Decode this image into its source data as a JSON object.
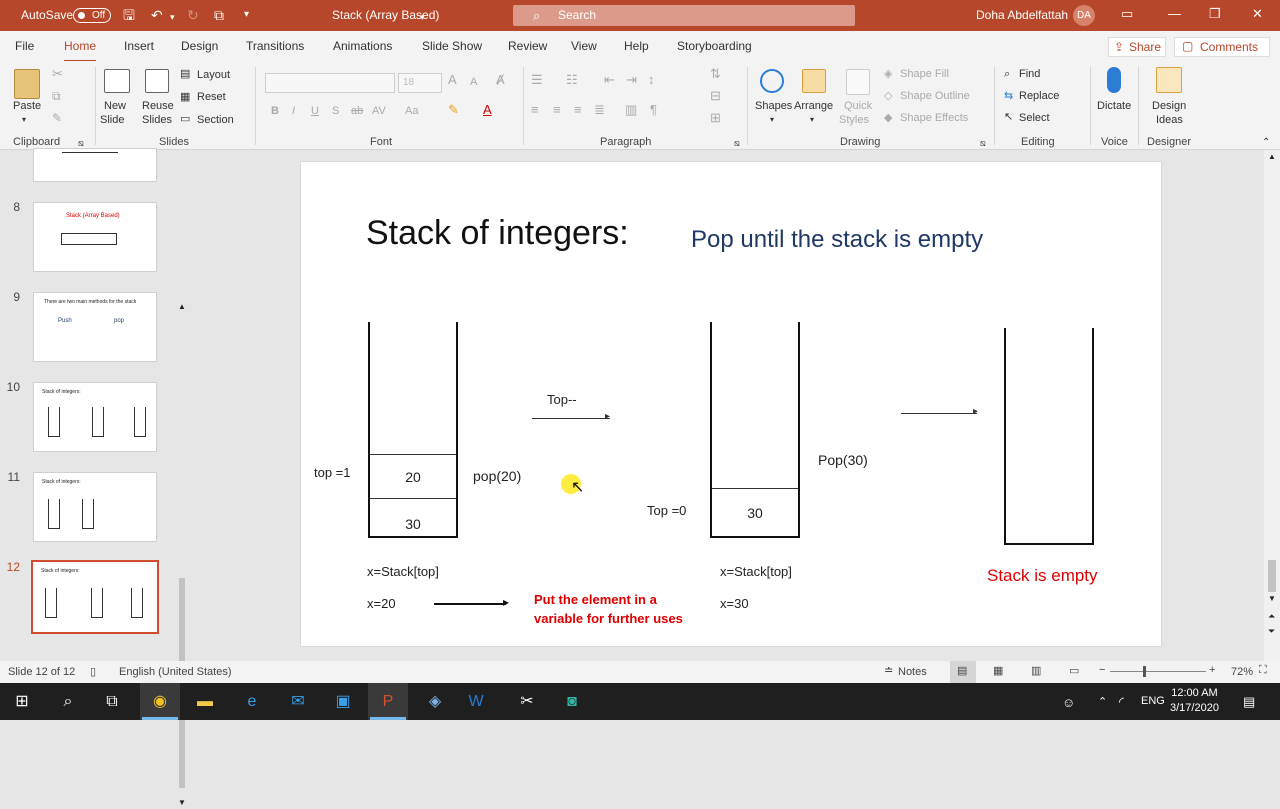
{
  "titlebar": {
    "autosave_label": "AutoSave",
    "autosave_state": "Off",
    "document_title": "Stack (Array Based)",
    "search_placeholder": "Search",
    "user_name": "Doha Abdelfattah",
    "user_initials": "DA"
  },
  "tabs": [
    "File",
    "Home",
    "Insert",
    "Design",
    "Transitions",
    "Animations",
    "Slide Show",
    "Review",
    "View",
    "Help",
    "Storyboarding"
  ],
  "active_tab": "Home",
  "share_label": "Share",
  "comments_label": "Comments",
  "ribbon": {
    "clipboard": {
      "paste": "Paste",
      "group": "Clipboard"
    },
    "slides": {
      "new_slide_1": "New",
      "new_slide_2": "Slide",
      "reuse_1": "Reuse",
      "reuse_2": "Slides",
      "layout": "Layout",
      "reset": "Reset",
      "section": "Section",
      "group": "Slides"
    },
    "font": {
      "size": "18",
      "group": "Font"
    },
    "paragraph": {
      "group": "Paragraph"
    },
    "drawing": {
      "shapes": "Shapes",
      "arrange": "Arrange",
      "quick_1": "Quick",
      "quick_2": "Styles",
      "shape_fill": "Shape Fill",
      "shape_outline": "Shape Outline",
      "shape_effects": "Shape Effects",
      "group": "Drawing"
    },
    "editing": {
      "find": "Find",
      "replace": "Replace",
      "select": "Select",
      "group": "Editing"
    },
    "voice": {
      "dictate": "Dictate",
      "group": "Voice"
    },
    "designer": {
      "ideas_1": "Design",
      "ideas_2": "Ideas",
      "group": "Designer"
    }
  },
  "thumbnails": [
    {
      "number": "8",
      "title": "Stack (Array Based)"
    },
    {
      "number": "9",
      "title": "There are two main methods for the stack",
      "push": "Push",
      "pop": "pop"
    },
    {
      "number": "10",
      "title": "Stack of integers:"
    },
    {
      "number": "11",
      "title": "Stack of integers:"
    },
    {
      "number": "12",
      "title": "Stack of integers:",
      "current": true
    }
  ],
  "slide": {
    "title": "Stack of integers:",
    "subtitle": "Pop until the stack is empty",
    "stack1_top": "top =1",
    "stack1_cells": [
      "20",
      "30"
    ],
    "pop1": "pop(20)",
    "top_decrement": "Top--",
    "stack2_top": "Top =0",
    "stack2_cell": "30",
    "pop2": "Pop(30)",
    "assign1": "x=Stack[top]",
    "x1": "x=20",
    "note_line1": "Put the element in a",
    "note_line2": "variable for further uses",
    "assign2": "x=Stack[top]",
    "x2": "x=30",
    "empty": "Stack is empty"
  },
  "status": {
    "slide_info": "Slide 12 of 12",
    "language": "English (United States)",
    "notes": "Notes",
    "zoom": "72%"
  },
  "clock": {
    "time": "12:00 AM",
    "date": "3/17/2020"
  },
  "tray": {
    "lang": "ENG"
  },
  "colors": {
    "accent": "#b7472a",
    "slide_subtitle": "#1f3864",
    "slide_red": "#e00000"
  }
}
